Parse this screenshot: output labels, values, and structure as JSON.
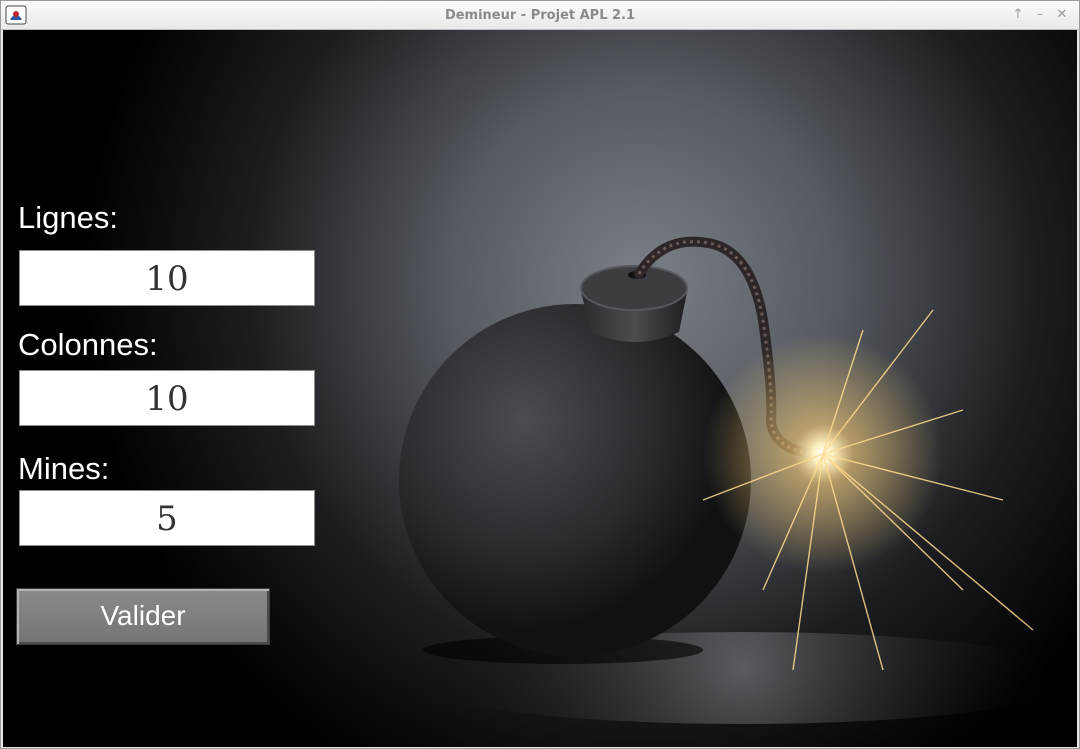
{
  "window": {
    "title": "Demineur - Projet APL 2.1",
    "controls": {
      "maximize": "↑",
      "minimize": "–",
      "close": "✕"
    }
  },
  "form": {
    "rows_label": "Lignes:",
    "rows_value": "10",
    "cols_label": "Colonnes:",
    "cols_value": "10",
    "mines_label": "Mines:",
    "mines_value": "5",
    "submit_label": "Valider"
  },
  "background": {
    "subject": "bomb-with-lit-fuse",
    "colors": {
      "backdrop": "#000000",
      "spotlight": "#7b7f86",
      "spark": "#ffd27a"
    }
  }
}
